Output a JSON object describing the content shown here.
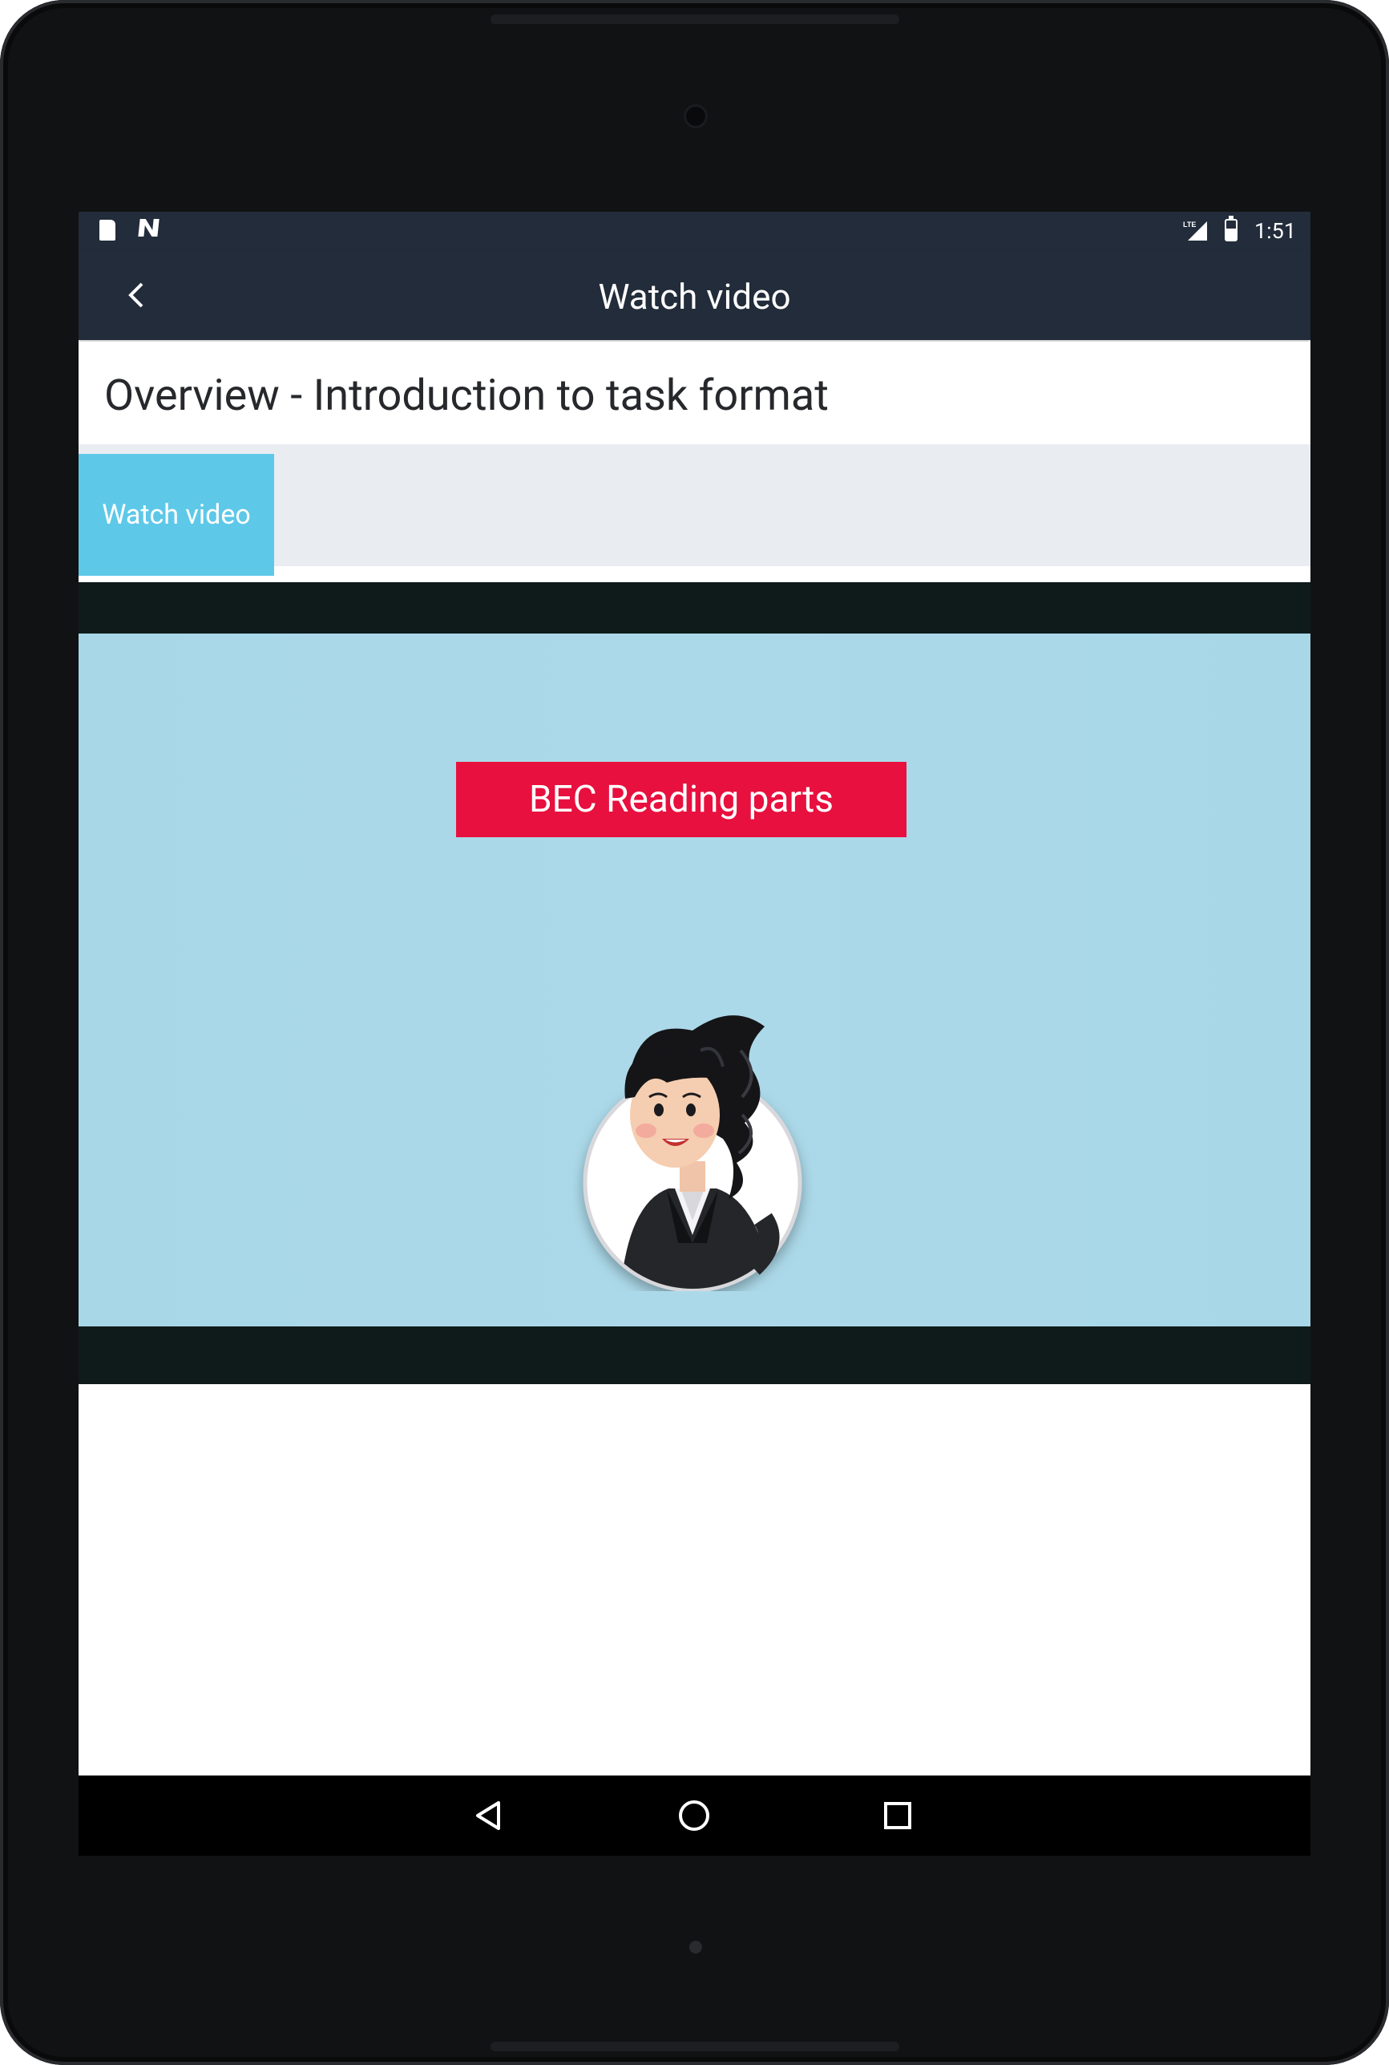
{
  "status_bar": {
    "time": "1:51",
    "network_label": "LTE",
    "icons": [
      "sd-card-icon",
      "n-notification-icon",
      "lte-signal-icon",
      "battery-charging-icon"
    ]
  },
  "app_bar": {
    "title": "Watch video",
    "back_icon": "chevron-left-icon"
  },
  "lesson": {
    "title": "Overview - Introduction to task format"
  },
  "tabs": [
    {
      "label": "Watch video",
      "selected": true,
      "color": "#5ec8e8"
    }
  ],
  "video": {
    "banner_text": "BEC Reading parts",
    "banner_color": "#e8103e",
    "background_color": "#a8d7e7",
    "character": "woman-presenter-avatar"
  },
  "nav_bar": {
    "icons": [
      "back-triangle-icon",
      "home-circle-icon",
      "recents-square-icon"
    ]
  },
  "colors": {
    "app_bar": "#222c3a",
    "tab_strip": "#e9ecf1",
    "video_letterbox": "#0f1b1b"
  }
}
